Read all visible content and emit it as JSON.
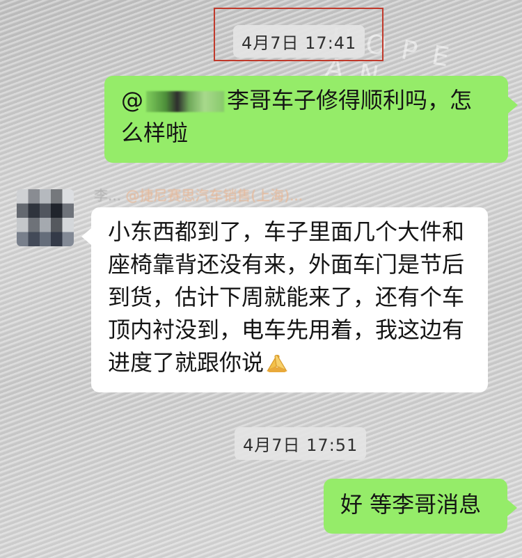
{
  "chat": {
    "messages": [
      {
        "type": "time",
        "text": "4月7日 17:41"
      },
      {
        "type": "sent",
        "mention": "@",
        "text": "李哥车子修得顺利吗，怎么样啦"
      },
      {
        "type": "received",
        "sender": "李...",
        "sender_tag": "@捷尼赛思汽车销售(上海)...",
        "text": "小东西都到了，车子里面几个大件和座椅靠背还没有来，外面车门是节后到货，估计下周就能来了，还有个车顶内衬没到，电车先用着，我这边有进度了就跟你说",
        "emoji": "folded-hands"
      },
      {
        "type": "time",
        "text": "4月7日 17:51"
      },
      {
        "type": "sent",
        "text": "好 等李哥消息"
      }
    ]
  },
  "background_text": "HOPE AN",
  "colors": {
    "sent_bubble": "#95ec69",
    "received_bubble": "#ffffff",
    "highlight": "#c0392b"
  }
}
